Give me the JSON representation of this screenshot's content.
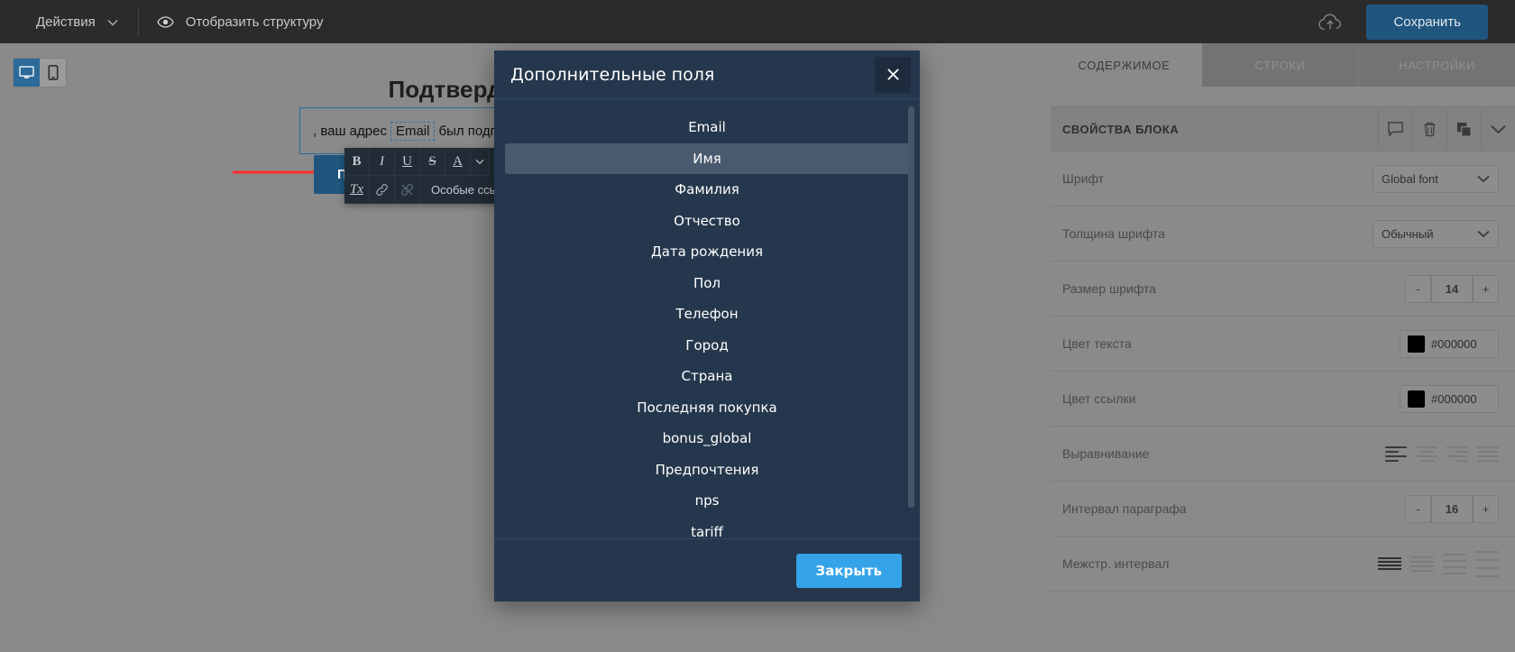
{
  "topbar": {
    "actions_label": "Действия",
    "structure_label": "Отобразить структуру",
    "save_label": "Сохранить",
    "cloud_icon": "cloud-upload-icon",
    "eye_icon": "eye-icon",
    "chevron_icon": "chevron-down-icon"
  },
  "device_toggle": {
    "desktop_icon": "desktop-icon",
    "mobile_icon": "mobile-icon",
    "active": "desktop"
  },
  "canvas": {
    "title": "Подтвердите подписку",
    "text_before": ", ваш адрес",
    "merge_tag": "Email",
    "text_after": "был подписан",
    "cta_label": "Подтвердить",
    "annotation_icon": "red-arrow-pointer"
  },
  "format_toolbar": {
    "bold": "B",
    "italic": "I",
    "underline": "U",
    "strike": "S",
    "text_color": "A",
    "color_chevron": "chevron-down-icon",
    "clear_format": "Tx",
    "link": "link-icon",
    "unlink": "unlink-icon",
    "special_links": "Особые ссылки"
  },
  "right_panel": {
    "tabs": [
      {
        "label": "СОДЕРЖИМОЕ",
        "active": true
      },
      {
        "label": "СТРОКИ",
        "active": false
      },
      {
        "label": "НАСТРОЙКИ",
        "active": false
      }
    ],
    "section_title": "СВОЙСТВА БЛОКА",
    "header_icons": [
      "comment-icon",
      "trash-icon",
      "duplicate-icon",
      "chevron-down-icon"
    ],
    "properties": [
      {
        "label": "Шрифт",
        "type": "select",
        "value": "Global font"
      },
      {
        "label": "Толщина шрифта",
        "type": "select",
        "value": "Обычный"
      },
      {
        "label": "Размер шрифта",
        "type": "stepper",
        "value": "14",
        "minus": "-",
        "plus": "+"
      },
      {
        "label": "Цвет текста",
        "type": "color",
        "value": "#000000",
        "swatch": "#000000"
      },
      {
        "label": "Цвет ссылки",
        "type": "color",
        "value": "#000000",
        "swatch": "#000000"
      },
      {
        "label": "Выравнивание",
        "type": "align",
        "active_index": 0
      },
      {
        "label": "Интервал параграфа",
        "type": "stepper",
        "value": "16",
        "minus": "-",
        "plus": "+"
      },
      {
        "label": "Межстр. интервал",
        "type": "lineheight",
        "active_index": 0
      }
    ]
  },
  "modal": {
    "title": "Дополнительные поля",
    "close_icon": "close-icon",
    "footer_button": "Закрыть",
    "hovered_index": 1,
    "fields": [
      "Email",
      "Имя",
      "Фамилия",
      "Отчество",
      "Дата рождения",
      "Пол",
      "Телефон",
      "Город",
      "Страна",
      "Последняя покупка",
      "bonus_global",
      "Предпочтения",
      "nps",
      "tariff"
    ]
  },
  "colors": {
    "topbar_bg": "#2b2b2b",
    "accent_blue": "#20557e",
    "modal_bg": "#25374c",
    "modal_button": "#34a3e8",
    "canvas_bg": "#8a8a8a"
  }
}
